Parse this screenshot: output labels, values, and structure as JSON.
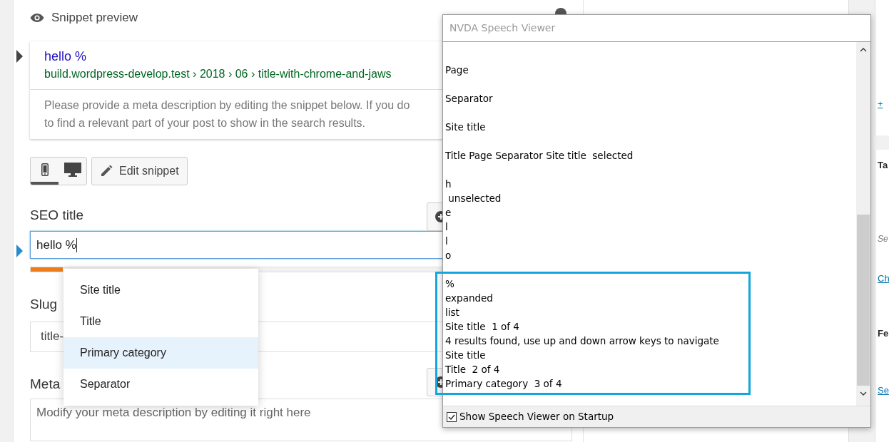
{
  "snippet_preview": {
    "heading": "Snippet preview",
    "title": "hello %",
    "url": "build.wordpress-develop.test › 2018 › 06 › title-with-chrome-and-jaws",
    "description": [
      "Please provide a meta description by editing the snippet below. If you do",
      "to find a relevant part of your post to show in the search results."
    ],
    "modes": [
      {
        "kind": "mobile",
        "selected": true
      },
      {
        "kind": "desktop",
        "selected": false
      }
    ],
    "edit_button": "Edit snippet"
  },
  "seo_title": {
    "label": "SEO title",
    "value": "hello %",
    "level": 0.06
  },
  "slug": {
    "label": "Slug",
    "value": "title-"
  },
  "meta": {
    "label": "Meta",
    "placeholder": "Modify your meta description by editing it right here"
  },
  "suggestions": [
    {
      "label": "Site title",
      "selected": false
    },
    {
      "label": "Title",
      "selected": false
    },
    {
      "label": "Primary category",
      "selected": true
    },
    {
      "label": "Separator",
      "selected": false
    }
  ],
  "sidebar_fragments": [
    {
      "kind": "link",
      "text": "+"
    },
    {
      "kind": "heading",
      "text": "Ta"
    },
    {
      "kind": "hint",
      "text": "Se"
    },
    {
      "kind": "link",
      "text": "Ch"
    },
    {
      "kind": "heading",
      "text": "Fe"
    },
    {
      "kind": "link",
      "text": "Se"
    }
  ],
  "speech_viewer": {
    "title": "NVDA Speech Viewer",
    "line_groups": [
      [
        "Page"
      ],
      [
        "Separator"
      ],
      [
        "Site title"
      ],
      [
        "Title Page Separator Site title  selected"
      ],
      [
        "h",
        " unselected",
        "e",
        "l",
        "l",
        "o"
      ],
      [
        "%",
        "expanded",
        "list",
        "Site title  1 of 4",
        "4 results found, use up and down arrow keys to navigate",
        "Site title",
        "Title  2 of 4",
        "Primary category  3 of 4"
      ]
    ],
    "startup_checkbox": {
      "label": "Show Speech Viewer on Startup",
      "checked": true
    }
  }
}
